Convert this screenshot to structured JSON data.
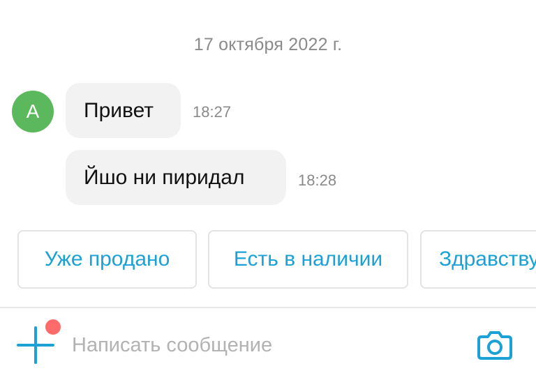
{
  "chat": {
    "date_separator": "17 октября 2022 г.",
    "contact_initial": "А",
    "messages": [
      {
        "text": "Привет",
        "time": "18:27"
      },
      {
        "text": "Йшо ни пиридал",
        "time": "18:28"
      }
    ]
  },
  "quick_replies": [
    {
      "label": "Уже продано"
    },
    {
      "label": "Есть в наличии"
    },
    {
      "label": "Здравствуйте"
    }
  ],
  "composer": {
    "placeholder": "Написать сообщение",
    "value": ""
  },
  "icons": {
    "add": "plus-icon",
    "camera": "camera-icon",
    "notification": "notification-dot-icon"
  },
  "colors": {
    "accent": "#1ba1d6",
    "avatar_bg": "#5cb85c",
    "bubble_bg": "#f2f2f2",
    "notification": "#ff6b6b",
    "muted_text": "#8a8a8a"
  }
}
